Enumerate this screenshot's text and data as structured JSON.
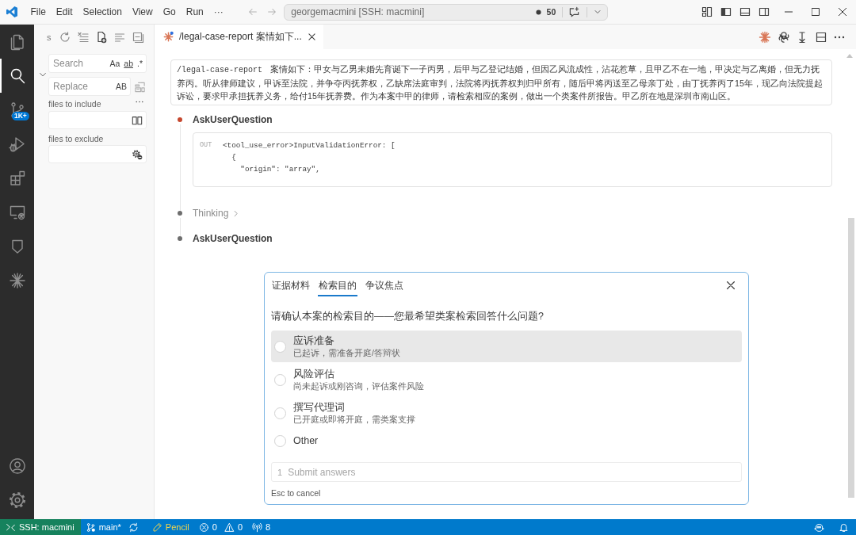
{
  "title_bar": {
    "menu": [
      "File",
      "Edit",
      "Selection",
      "View",
      "Go",
      "Run"
    ],
    "overflow": "···",
    "command_center": {
      "title": "georgemacmini [SSH: macmini]",
      "count": "50"
    }
  },
  "activity_bar": {
    "items": [
      {
        "selected": false
      },
      {
        "selected": true
      },
      {
        "selected": false,
        "badge": "1K+"
      },
      {
        "selected": false
      },
      {
        "selected": false
      },
      {
        "selected": false
      },
      {
        "selected": false
      },
      {
        "selected": false
      }
    ]
  },
  "search_panel": {
    "title": "s",
    "search": {
      "placeholder": "Search",
      "toggles": [
        "Aa",
        "ab",
        ".*"
      ]
    },
    "replace": {
      "placeholder": "Replace",
      "toggles": [
        "AB"
      ]
    },
    "include": {
      "label": "files to include"
    },
    "exclude": {
      "label": "files to exclude"
    }
  },
  "editor_tabs": [
    {
      "label": "/legal-case-report 案情如下...",
      "selected": true
    }
  ],
  "chat": {
    "prompt": {
      "command": "/legal-case-report",
      "text": "案情如下：甲女与乙男未婚先育诞下一子丙男，后甲与乙登记结婚，但因乙风流成性，沾花惹草，且甲乙不在一地，甲决定与乙离婚，但无力抚养丙。听从律师建议，甲诉至法院，并争夺丙抚养权，乙缺席法庭审判，法院将丙抚养权判归甲所有，随后甲将丙送至乙母亲丁处，由丁抚养丙了15年，现乙向法院提起诉讼，要求甲承担抚养义务，给付15年抚养费。作为本案中甲的律师，请检索相应的案例，做出一个类案件所报告。甲乙所在地是深圳市南山区。"
    },
    "steps": [
      {
        "kind": "tool",
        "title": "AskUserQuestion",
        "color": "#c6482f",
        "output": {
          "label": "OUT",
          "lines": [
            "<tool_use_error>InputValidationError: [",
            "  {",
            "    \"origin\": \"array\","
          ]
        }
      },
      {
        "kind": "thinking",
        "title": "Thinking",
        "color": "#6e6e6e"
      },
      {
        "kind": "tool",
        "title": "AskUserQuestion",
        "color": "#6e6e6e"
      }
    ]
  },
  "question_dialog": {
    "tabs": [
      {
        "label": "证据材料",
        "selected": false
      },
      {
        "label": "检索目的",
        "selected": true
      },
      {
        "label": "争议焦点",
        "selected": false
      }
    ],
    "question": "请确认本案的检索目的——您最希望类案检索回答什么问题?",
    "options": [
      {
        "label": "应诉准备",
        "description": "已起诉，需准备开庭/答辩状",
        "highlighted": true,
        "selected": false
      },
      {
        "label": "风险评估",
        "description": "尚未起诉或刚咨询，评估案件风险",
        "highlighted": false,
        "selected": false
      },
      {
        "label": "撰写代理词",
        "description": "已开庭或即将开庭，需类案支撑",
        "highlighted": false,
        "selected": false
      },
      {
        "label": "Other",
        "highlighted": false,
        "selected": false
      }
    ],
    "submit": {
      "number": "1",
      "label": "Submit answers",
      "disabled": true
    },
    "hint": "Esc to cancel"
  },
  "status_bar": {
    "remote": "SSH: macmini",
    "branch": "main*",
    "mode": "Pencil",
    "errors": "0",
    "warnings": "0",
    "ports": "8"
  }
}
